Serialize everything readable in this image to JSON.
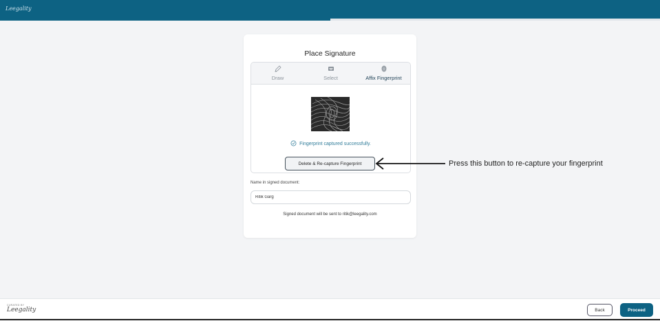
{
  "header": {
    "logo_text": "Leegality",
    "progress_percent": 50
  },
  "card": {
    "title": "Place Signature",
    "tabs": [
      {
        "label": "Draw",
        "icon": "pen-icon"
      },
      {
        "label": "Select",
        "icon": "keyboard-icon"
      },
      {
        "label": "Affix Fingerprint",
        "icon": "fingerprint-icon"
      }
    ],
    "active_tab": "Affix Fingerprint",
    "status_text": "Fingerprint captured successfully.",
    "recapture_label": "Delete & Re-capture Fingerprint",
    "name_label": "Name in signed document:",
    "name_value": "Ritik Garg",
    "sent_note": "Signed document will be sent to ritik@leegality.com"
  },
  "annotation": {
    "text": "Press this button to re-capture your fingerprint"
  },
  "footer": {
    "powered_by": "CURATED BY",
    "brand": "Leegality",
    "back_label": "Back",
    "proceed_label": "Proceed"
  },
  "colors": {
    "brand": "#0d6283",
    "status": "#2d7a98"
  }
}
